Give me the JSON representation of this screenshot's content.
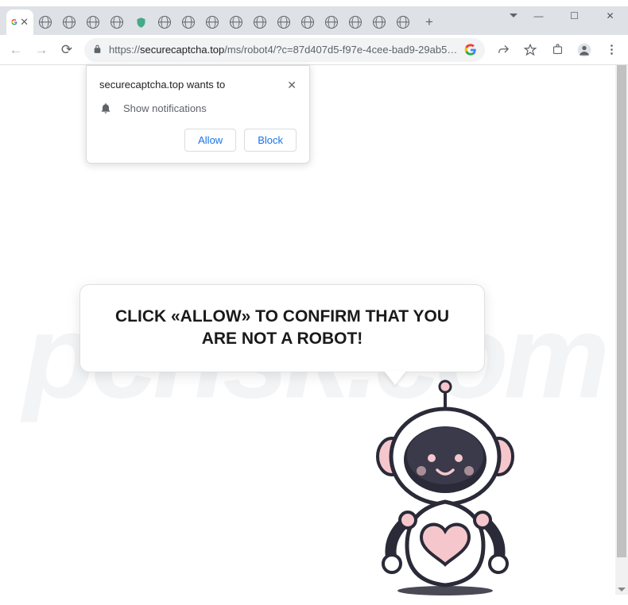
{
  "window": {
    "minimize": "—",
    "maximize": "☐",
    "close": "✕"
  },
  "tabs": {
    "active_favicon": "google-logo",
    "newtab_label": "+"
  },
  "toolbar": {
    "url_scheme": "https://",
    "url_domain": "securecaptcha.top",
    "url_path": "/ms/robot4/?c=87d407d5-f97e-4cee-bad9-29ab5bd45b...",
    "back": "←",
    "forward": "→",
    "reload": "⟳"
  },
  "permission": {
    "title": "securecaptcha.top wants to",
    "body": "Show notifications",
    "allow": "Allow",
    "block": "Block",
    "close": "✕"
  },
  "page": {
    "speech": "CLICK «ALLOW» TO CONFIRM THAT YOU ARE NOT A ROBOT!"
  },
  "watermark": "pcrisk.com"
}
